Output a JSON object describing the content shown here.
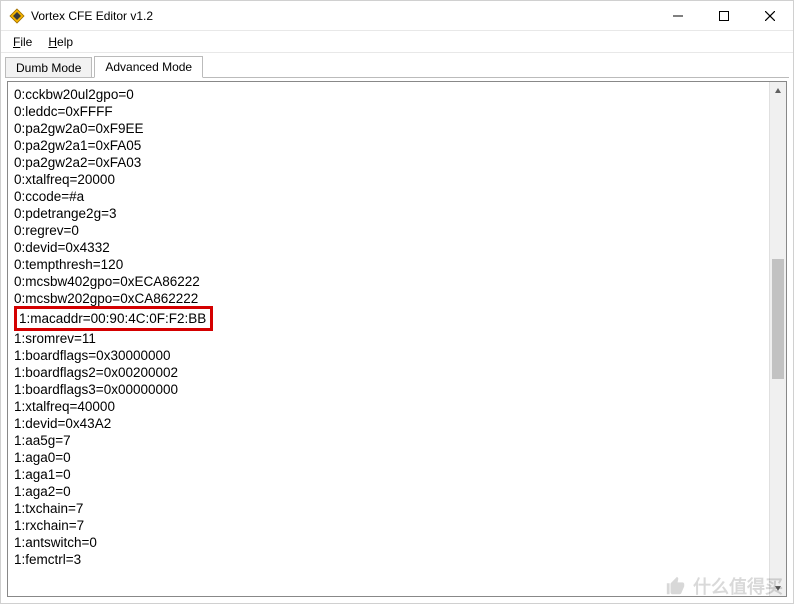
{
  "titlebar": {
    "app_title": "Vortex CFE Editor v1.2"
  },
  "menu": {
    "file": {
      "prefix": "F",
      "rest": "ile"
    },
    "help": {
      "prefix": "H",
      "rest": "elp"
    }
  },
  "tabs": {
    "dumb": "Dumb Mode",
    "advanced": "Advanced Mode",
    "active_index": 1
  },
  "editor": {
    "highlight_index": 13,
    "lines": [
      "0:cckbw20ul2gpo=0",
      "0:leddc=0xFFFF",
      "0:pa2gw2a0=0xF9EE",
      "0:pa2gw2a1=0xFA05",
      "0:pa2gw2a2=0xFA03",
      "0:xtalfreq=20000",
      "0:ccode=#a",
      "0:pdetrange2g=3",
      "0:regrev=0",
      "0:devid=0x4332",
      "0:tempthresh=120",
      "0:mcsbw402gpo=0xECA86222",
      "0:mcsbw202gpo=0xCA862222",
      "1:macaddr=00:90:4C:0F:F2:BB",
      "1:sromrev=11",
      "1:boardflags=0x30000000",
      "1:boardflags2=0x00200002",
      "1:boardflags3=0x00000000",
      "1:xtalfreq=40000",
      "1:devid=0x43A2",
      "1:aa5g=7",
      "1:aga0=0",
      "1:aga1=0",
      "1:aga2=0",
      "1:txchain=7",
      "1:rxchain=7",
      "1:antswitch=0",
      "1:femctrl=3"
    ]
  },
  "watermark": {
    "text": "什么值得买"
  }
}
